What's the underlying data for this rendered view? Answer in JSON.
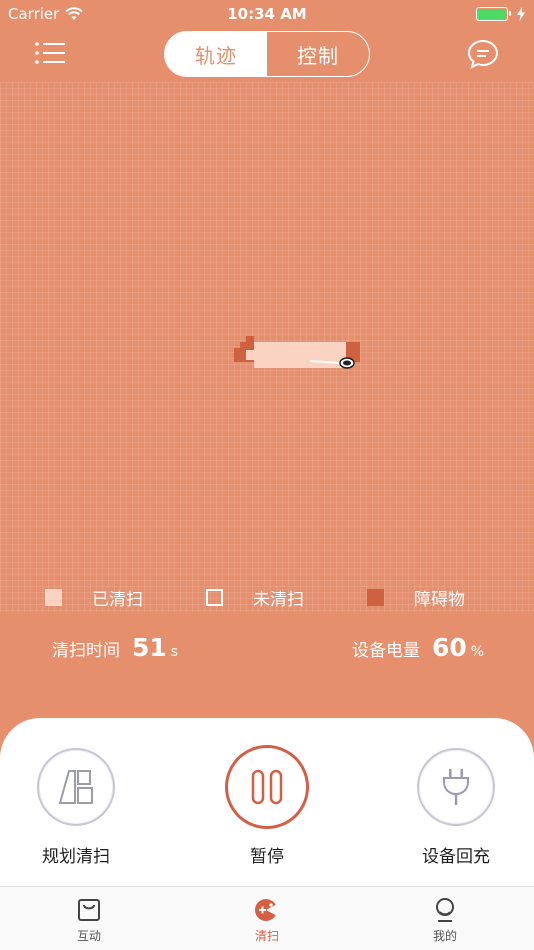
{
  "status_bar": {
    "carrier": "Carrier",
    "time": "10:34 AM"
  },
  "nav": {
    "tabs": [
      {
        "label": "轨迹",
        "active": true
      },
      {
        "label": "控制",
        "active": false
      }
    ],
    "menu_icon": "list-menu-icon",
    "chat_icon": "chat-bubble-icon"
  },
  "legend": {
    "cleaned": "已清扫",
    "uncleaned": "未清扫",
    "obstacle": "障碍物"
  },
  "stats": {
    "clean_time_label": "清扫时间",
    "clean_time_value": "51",
    "clean_time_unit": "s",
    "battery_label": "设备电量",
    "battery_value": "60",
    "battery_unit": "%"
  },
  "controls": {
    "plan": "规划清扫",
    "pause": "暂停",
    "recharge": "设备回充"
  },
  "tab_bar": {
    "items": [
      {
        "label": "互动",
        "active": false
      },
      {
        "label": "清扫",
        "active": true
      },
      {
        "label": "我的",
        "active": false
      }
    ]
  },
  "colors": {
    "background": "#e58f6d",
    "accent": "#d45f44",
    "cleaned": "#fbd3c2",
    "obstacle": "#cf6040"
  }
}
